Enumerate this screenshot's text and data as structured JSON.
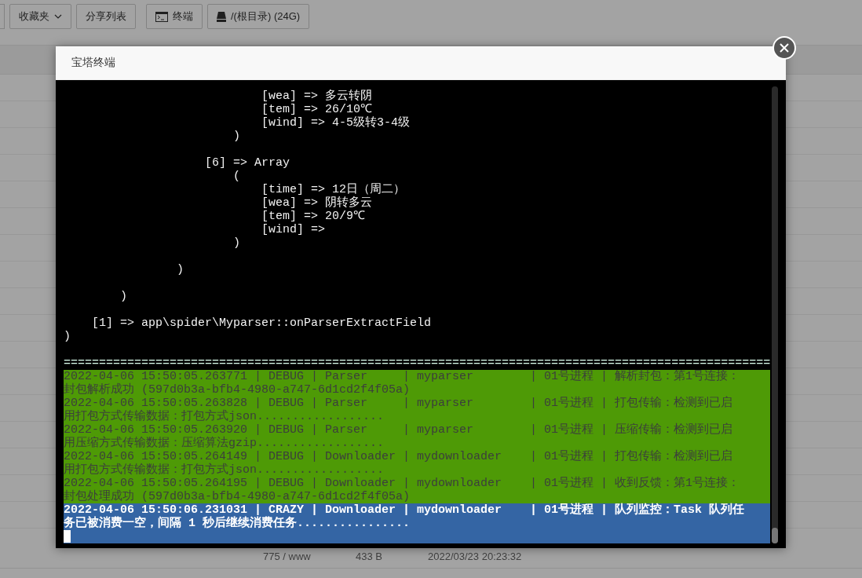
{
  "toolbar": {
    "buttons": [
      {
        "label": "收藏夹",
        "kind": "dropdown"
      },
      {
        "label": "分享列表",
        "kind": "plain"
      },
      {
        "label": "终端",
        "kind": "terminal"
      },
      {
        "label": "/(根目录) (24G)",
        "kind": "disk"
      }
    ]
  },
  "file_row": {
    "cells": [
      "775 / www",
      "433 B",
      "2022/03/23 20:23:32"
    ]
  },
  "dialog": {
    "title": "宝塔终端",
    "terminal": {
      "lines": [
        {
          "kind": "output",
          "text": "                            [wea] => 多云转阴"
        },
        {
          "kind": "output",
          "text": "                            [tem] => 26/10℃"
        },
        {
          "kind": "output",
          "text": "                            [wind] => 4-5级转3-4级"
        },
        {
          "kind": "output",
          "text": "                        )"
        },
        {
          "kind": "blank"
        },
        {
          "kind": "output",
          "text": "                    [6] => Array"
        },
        {
          "kind": "output",
          "text": "                        ("
        },
        {
          "kind": "output",
          "text": "                            [time] => 12日（周二）"
        },
        {
          "kind": "output",
          "text": "                            [wea] => 阴转多云"
        },
        {
          "kind": "output",
          "text": "                            [tem] => 20/9℃"
        },
        {
          "kind": "output",
          "text": "                            [wind] =>"
        },
        {
          "kind": "output",
          "text": "                        )"
        },
        {
          "kind": "blank"
        },
        {
          "kind": "output",
          "text": "                )"
        },
        {
          "kind": "blank"
        },
        {
          "kind": "output",
          "text": "        )"
        },
        {
          "kind": "blank"
        },
        {
          "kind": "output",
          "text": "    [1] => app\\spider\\Myparser::onParserExtractField"
        },
        {
          "kind": "output",
          "text": ")"
        },
        {
          "kind": "blank"
        },
        {
          "kind": "rule",
          "text": "===================================================================================================="
        },
        {
          "kind": "debug",
          "text": "2022-04-06 15:50:05.263771 | DEBUG | Parser     | myparser        | 01号进程 | 解析封包：第1号连接："
        },
        {
          "kind": "debug",
          "text": "封包解析成功 (597d0b3a-bfb4-4980-a747-6d1cd2f4f05a)"
        },
        {
          "kind": "debug",
          "text": "2022-04-06 15:50:05.263828 | DEBUG | Parser     | myparser        | 01号进程 | 打包传输：检测到已启"
        },
        {
          "kind": "debug",
          "text": "用打包方式传输数据：打包方式json.................."
        },
        {
          "kind": "debug",
          "text": "2022-04-06 15:50:05.263920 | DEBUG | Parser     | myparser        | 01号进程 | 压缩传输：检测到已启"
        },
        {
          "kind": "debug",
          "text": "用压缩方式传输数据：压缩算法gzip.................."
        },
        {
          "kind": "debug",
          "text": "2022-04-06 15:50:05.264149 | DEBUG | Downloader | mydownloader    | 01号进程 | 打包传输：检测到已启"
        },
        {
          "kind": "debug",
          "text": "用打包方式传输数据：打包方式json.................."
        },
        {
          "kind": "debug",
          "text": "2022-04-06 15:50:05.264195 | DEBUG | Downloader | mydownloader    | 01号进程 | 收到反馈：第1号连接："
        },
        {
          "kind": "debug",
          "text": "封包处理成功 (597d0b3a-bfb4-4980-a747-6d1cd2f4f05a)"
        },
        {
          "kind": "crazy",
          "text": "2022-04-06 15:50:06.231031 | CRAZY | Downloader | mydownloader    | 01号进程 | 队列监控：Task 队列任"
        },
        {
          "kind": "crazy",
          "text": "务已被消费一空，间隔 1 秒后继续消费任务................"
        },
        {
          "kind": "cursor"
        }
      ]
    }
  }
}
